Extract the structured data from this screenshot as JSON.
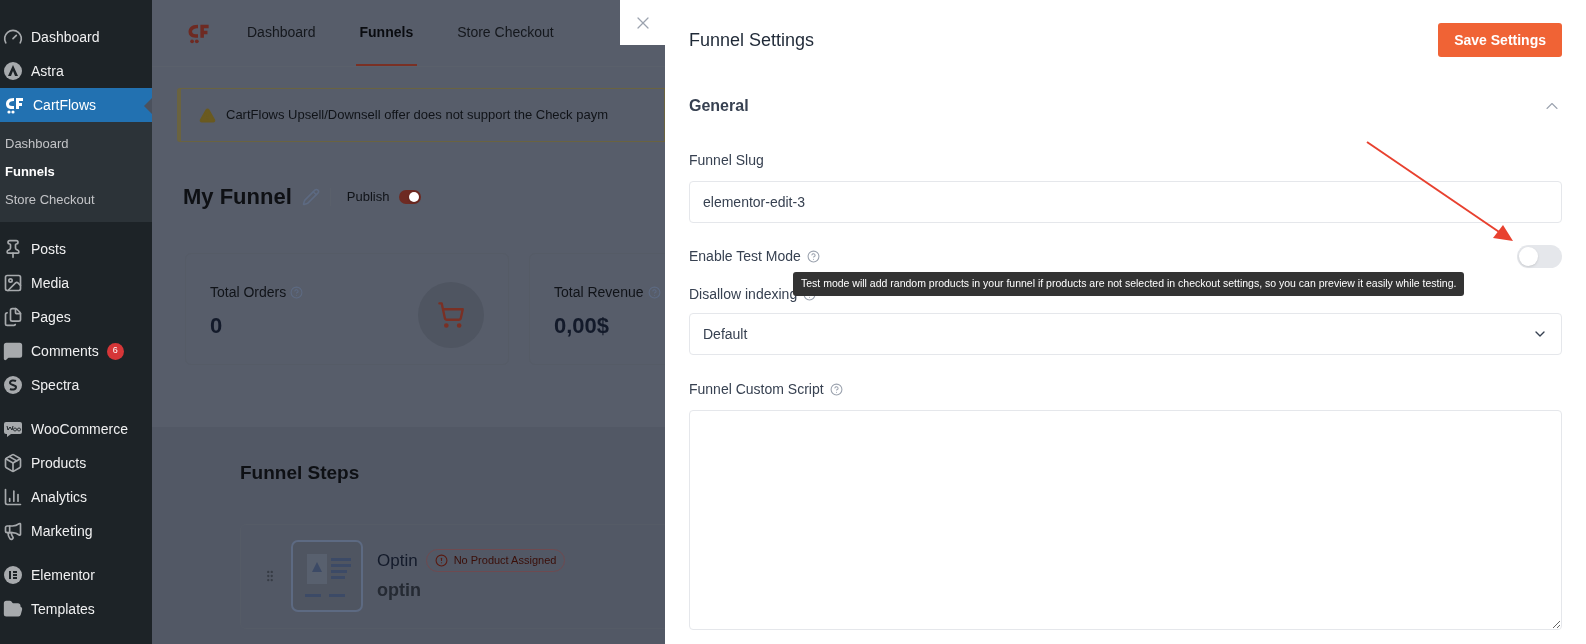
{
  "sidebar": {
    "groups": [
      [
        {
          "label": "Dashboard",
          "selected": false
        },
        {
          "label": "Astra",
          "selected": false
        },
        {
          "label": "CartFlows",
          "selected": true,
          "children": [
            {
              "label": "Dashboard",
              "selected": false
            },
            {
              "label": "Funnels",
              "selected": true
            },
            {
              "label": "Store Checkout",
              "selected": false
            }
          ]
        }
      ],
      [
        {
          "label": "Posts",
          "selected": false
        },
        {
          "label": "Media",
          "selected": false
        },
        {
          "label": "Pages",
          "selected": false
        },
        {
          "label": "Comments",
          "selected": false,
          "badge": "6"
        },
        {
          "label": "Spectra",
          "selected": false
        }
      ],
      [
        {
          "label": "WooCommerce",
          "selected": false
        },
        {
          "label": "Products",
          "selected": false
        },
        {
          "label": "Analytics",
          "selected": false
        },
        {
          "label": "Marketing",
          "selected": false
        }
      ],
      [
        {
          "label": "Elementor",
          "selected": false
        },
        {
          "label": "Templates",
          "selected": false
        }
      ]
    ]
  },
  "page": {
    "tabs": [
      {
        "label": "Dashboard",
        "selected": false
      },
      {
        "label": "Funnels",
        "selected": true
      },
      {
        "label": "Store Checkout",
        "selected": false
      }
    ],
    "notice": "CartFlows Upsell/Downsell offer does not support the Check paym",
    "title": "My Funnel",
    "publish_label": "Publish",
    "published": true,
    "stats": [
      {
        "label": "Total Orders",
        "value": "0"
      },
      {
        "label": "Total Revenue",
        "value": "0,00$"
      }
    ],
    "steps_title": "Funnel Steps",
    "step": {
      "type": "Optin",
      "badge": "No Product Assigned",
      "name": "optin"
    }
  },
  "panel": {
    "title": "Funnel Settings",
    "save": "Save Settings",
    "section": {
      "title": "General",
      "expanded": true
    },
    "slug": {
      "label": "Funnel Slug",
      "value": "elementor-edit-3"
    },
    "test_mode": {
      "label": "Enable Test Mode",
      "on": false,
      "tooltip": "Test mode will add random products in your funnel if products are not selected in checkout settings, so you can preview it easily while testing."
    },
    "indexing": {
      "label": "Disallow indexing",
      "value": "Default"
    },
    "script": {
      "label": "Funnel Custom Script"
    }
  }
}
